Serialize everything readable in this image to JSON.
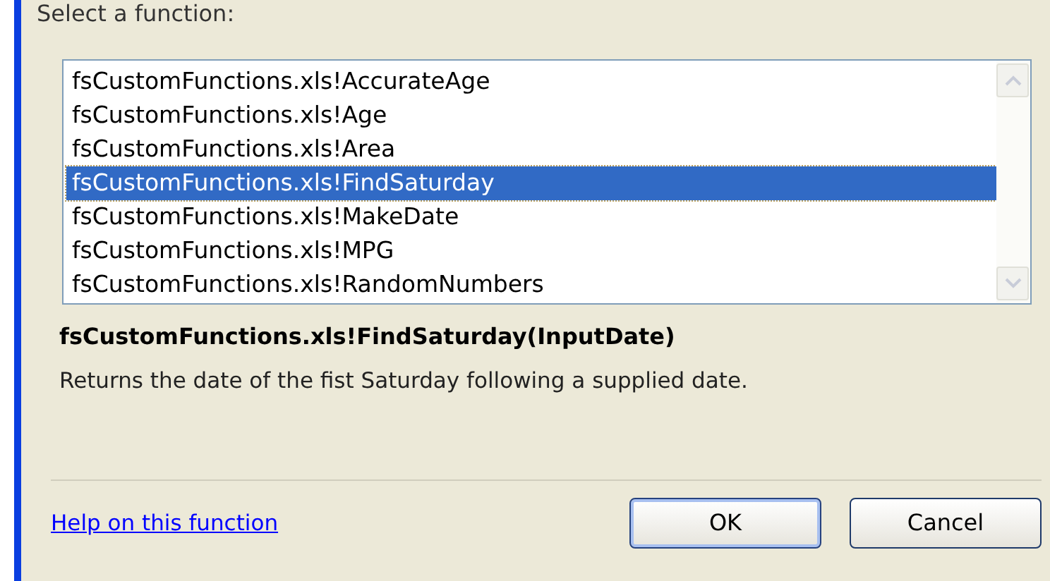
{
  "label": "Select a function:",
  "functions": [
    {
      "name": "fsCustomFunctions.xls!AccurateAge",
      "selected": false
    },
    {
      "name": "fsCustomFunctions.xls!Age",
      "selected": false
    },
    {
      "name": "fsCustomFunctions.xls!Area",
      "selected": false
    },
    {
      "name": "fsCustomFunctions.xls!FindSaturday",
      "selected": true
    },
    {
      "name": "fsCustomFunctions.xls!MakeDate",
      "selected": false
    },
    {
      "name": "fsCustomFunctions.xls!MPG",
      "selected": false
    },
    {
      "name": "fsCustomFunctions.xls!RandomNumbers",
      "selected": false
    }
  ],
  "signature": "fsCustomFunctions.xls!FindSaturday(InputDate)",
  "description": "Returns the date of the fist Saturday following a supplied date.",
  "help_link": "Help on this function",
  "buttons": [
    "OK",
    "Cancel"
  ]
}
